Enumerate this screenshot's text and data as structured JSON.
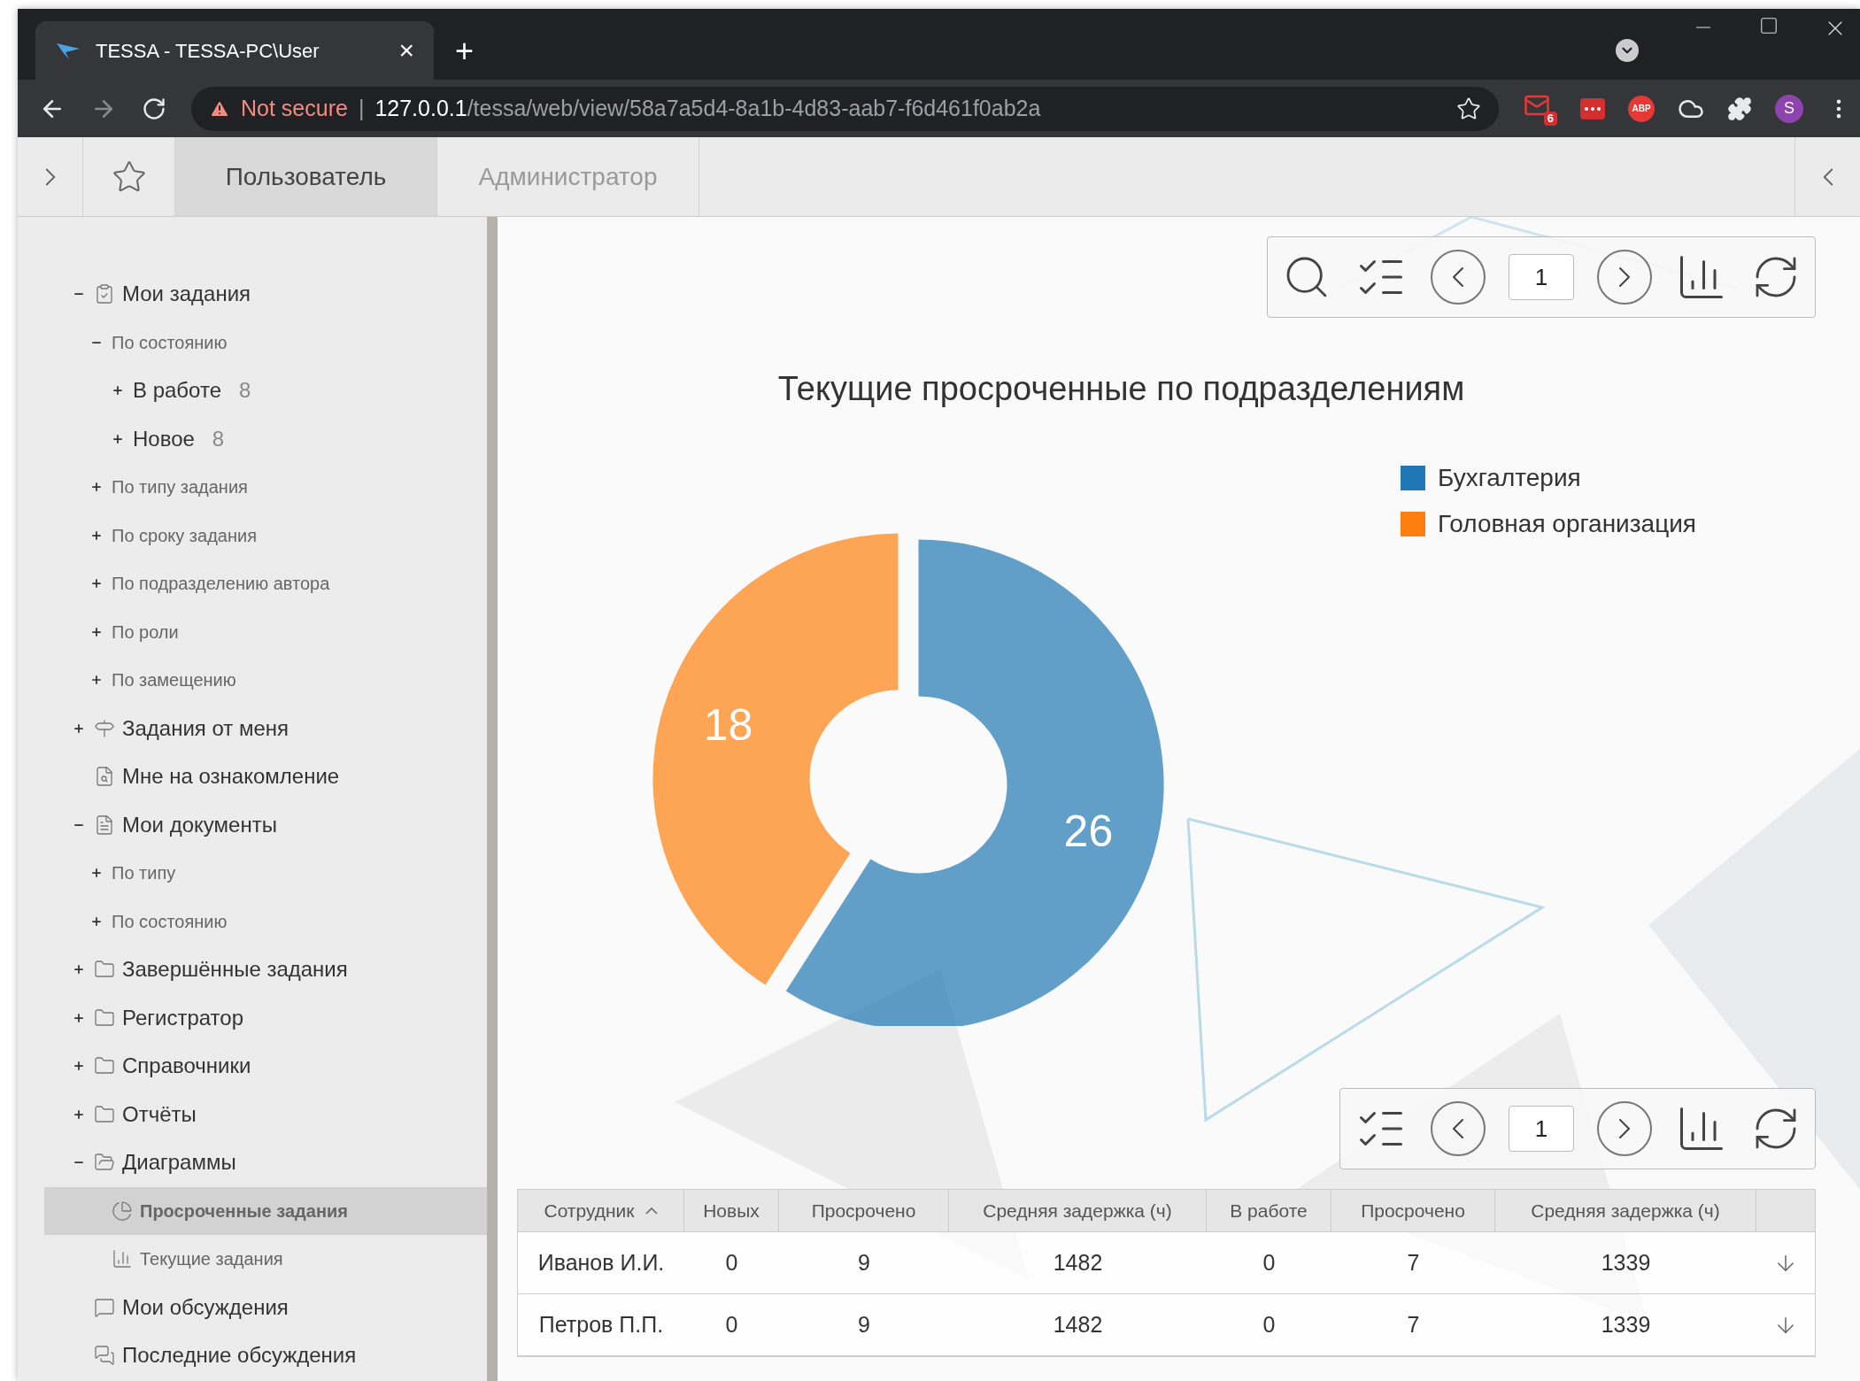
{
  "browser": {
    "tab_title": "TESSA - TESSA-PC\\User",
    "tab_close": "×",
    "new_tab": "+",
    "security": "Not secure",
    "separator": "|",
    "url_host": "127.0.0.1",
    "url_path": "/tessa/web/view/58a7a5d4-8a1b-4d83-aab7-f6d461f0ab2a",
    "mail_badge": "6",
    "abp": "ABP",
    "avatar": "S"
  },
  "app_tabs": [
    {
      "label": "Пользователь",
      "selected": true
    },
    {
      "label": "Администратор",
      "selected": false
    }
  ],
  "sidebar": {
    "items": [
      {
        "label": "Мои задания",
        "kind": "tasks",
        "expanded": true,
        "selected": false,
        "children": [
          {
            "label": "По состоянию",
            "kind": "none",
            "expanded": true,
            "selected": false,
            "children": [
              {
                "label": "В работе",
                "count": "8",
                "expanded": false,
                "selected": false
              },
              {
                "label": "Новое",
                "count": "8",
                "expanded": false,
                "selected": false
              }
            ]
          },
          {
            "label": "По типу задания",
            "kind": "none",
            "expanded": false,
            "selected": false
          },
          {
            "label": "По сроку задания",
            "kind": "none",
            "expanded": false,
            "selected": false
          },
          {
            "label": "По подразделению автора",
            "kind": "none",
            "expanded": false,
            "selected": false
          },
          {
            "label": "По роли",
            "kind": "none",
            "expanded": false,
            "selected": false
          },
          {
            "label": "По замещению",
            "kind": "none",
            "expanded": false,
            "selected": false
          }
        ]
      },
      {
        "label": "Задания от меня",
        "kind": "signpost",
        "expanded": false,
        "selected": false
      },
      {
        "label": "Мне на ознакомление",
        "kind": "review",
        "selected": false
      },
      {
        "label": "Мои документы",
        "kind": "document",
        "expanded": true,
        "selected": false,
        "children": [
          {
            "label": "По типу",
            "kind": "none",
            "expanded": false,
            "selected": false
          },
          {
            "label": "По состоянию",
            "kind": "none",
            "expanded": false,
            "selected": false
          }
        ]
      },
      {
        "label": "Завершённые задания",
        "kind": "folder",
        "expanded": false,
        "selected": false
      },
      {
        "label": "Регистратор",
        "kind": "folder",
        "expanded": false,
        "selected": false
      },
      {
        "label": "Справочники",
        "kind": "folder",
        "expanded": false,
        "selected": false
      },
      {
        "label": "Отчёты",
        "kind": "folder",
        "expanded": false,
        "selected": false
      },
      {
        "label": "Диаграммы",
        "kind": "folder-open",
        "expanded": true,
        "selected": false,
        "children": [
          {
            "label": "Просроченные задания",
            "kind": "pie",
            "selected": true
          },
          {
            "label": "Текущие задания",
            "kind": "bars",
            "selected": false
          }
        ]
      },
      {
        "label": "Мои обсуждения",
        "kind": "chat",
        "selected": false
      },
      {
        "label": "Последние обсуждения",
        "kind": "chats",
        "selected": false
      }
    ]
  },
  "chart_toolbar": {
    "page": "1"
  },
  "chart": {
    "chart_data": {
      "type": "donut",
      "title": "Текущие просроченные по подразделениям",
      "categories": [
        "Бухгалтерия",
        "Головная организация"
      ],
      "values": [
        26,
        18
      ],
      "colors": [
        "#1f77b4",
        "#ff7f0e"
      ],
      "data_labels": true,
      "legend": "right"
    }
  },
  "table_toolbar": {
    "page": "1"
  },
  "table": {
    "columns": [
      {
        "label": "Сотрудник",
        "sorted": true
      },
      {
        "label": "Новых",
        "sorted": false
      },
      {
        "label": "Просрочено",
        "sorted": false
      },
      {
        "label": "Средняя задержка (ч)",
        "sorted": false
      },
      {
        "label": "В работе",
        "sorted": false
      },
      {
        "label": "Просрочено",
        "sorted": false
      },
      {
        "label": "Средняя задержка (ч)",
        "sorted": false
      }
    ],
    "rows": [
      [
        "Иванов И.И.",
        "0",
        "9",
        "1482",
        "0",
        "7",
        "1339"
      ],
      [
        "Петров П.П.",
        "0",
        "9",
        "1482",
        "0",
        "7",
        "1339"
      ]
    ]
  }
}
